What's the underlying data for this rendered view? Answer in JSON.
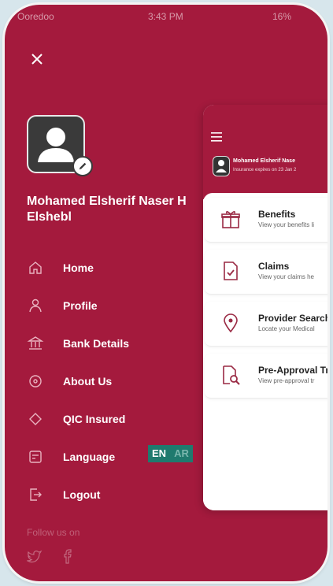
{
  "colors": {
    "brand": "#a41a3d",
    "accent": "#1f7a6e"
  },
  "status_bar": {
    "carrier": "Ooredoo",
    "time": "3:43 PM",
    "battery": "16%"
  },
  "user": {
    "name": "Mohamed Elsherif Naser H Elshebl"
  },
  "menu": [
    {
      "label": "Home",
      "icon": "home-icon"
    },
    {
      "label": "Profile",
      "icon": "user-icon"
    },
    {
      "label": "Bank Details",
      "icon": "bank-icon"
    },
    {
      "label": "About Us",
      "icon": "location-icon"
    },
    {
      "label": "QIC Insured",
      "icon": "diamond-icon"
    },
    {
      "label": "Language",
      "icon": "document-icon"
    },
    {
      "label": "Logout",
      "icon": "logout-icon"
    }
  ],
  "language": {
    "en": "EN",
    "ar": "AR",
    "selected": "EN"
  },
  "footer": {
    "follow_label": "Follow us on",
    "social": [
      "twitter-icon",
      "facebook-icon"
    ]
  },
  "preview": {
    "user_name": "Mohamed Elsherif Nase",
    "expiry": "Insurance expires on 23 Jan 2",
    "items": [
      {
        "title": "Benefits",
        "subtitle": "View your benefits li",
        "icon": "gift-icon"
      },
      {
        "title": "Claims",
        "subtitle": "View your claims he",
        "icon": "claim-icon"
      },
      {
        "title": "Provider Search",
        "subtitle": "Locate your Medical",
        "icon": "map-pin-icon"
      },
      {
        "title": "Pre-Approval Tr",
        "subtitle": "View pre-approval tr",
        "icon": "doc-search-icon"
      }
    ]
  }
}
